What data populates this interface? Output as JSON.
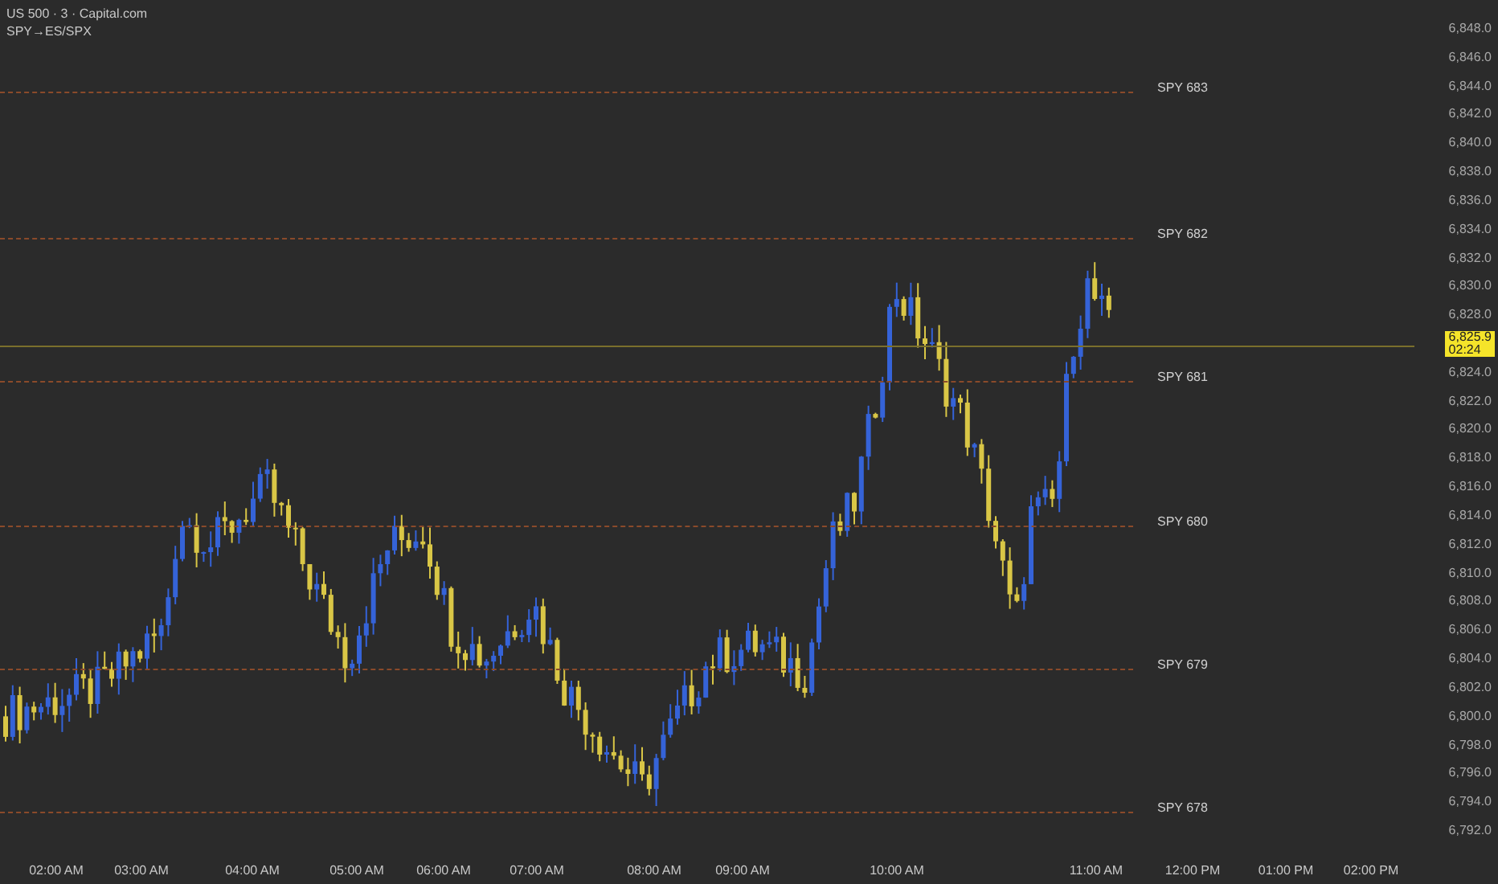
{
  "chart": {
    "title": "US 500 · 3 · Capital.com",
    "indicator": "SPY→ES/SPX",
    "price_levels": [
      {
        "label": "SPY 683"
      },
      {
        "label": "SPY 682"
      },
      {
        "label": "SPY 681"
      },
      {
        "label": "SPY 680"
      },
      {
        "label": "SPY 679"
      },
      {
        "label": "SPY 678"
      }
    ],
    "y_axis_labels": [
      "6,848.0",
      "6,846.0",
      "6,844.0",
      "6,842.0",
      "6,840.0",
      "6,838.0",
      "6,836.0",
      "6,834.0",
      "6,832.0",
      "6,830.0",
      "6,828.0",
      "6,824.0",
      "6,822.0",
      "6,820.0",
      "6,818.0",
      "6,816.0",
      "6,814.0",
      "6,812.0",
      "6,810.0",
      "6,808.0",
      "6,806.0",
      "6,804.0",
      "6,802.0",
      "6,800.0",
      "6,798.0",
      "6,796.0",
      "6,794.0",
      "6,792.0"
    ],
    "x_axis_labels": [
      "02:00 AM",
      "03:00 AM",
      "04:00 AM",
      "05:00 AM",
      "06:00 AM",
      "07:00 AM",
      "08:00 AM",
      "09:00 AM",
      "10:00 AM",
      "11:00 AM",
      "12:00 PM",
      "01:00 PM",
      "02:00 PM"
    ],
    "last_price": {
      "price": "6,825.9",
      "countdown": "02:24"
    }
  }
}
